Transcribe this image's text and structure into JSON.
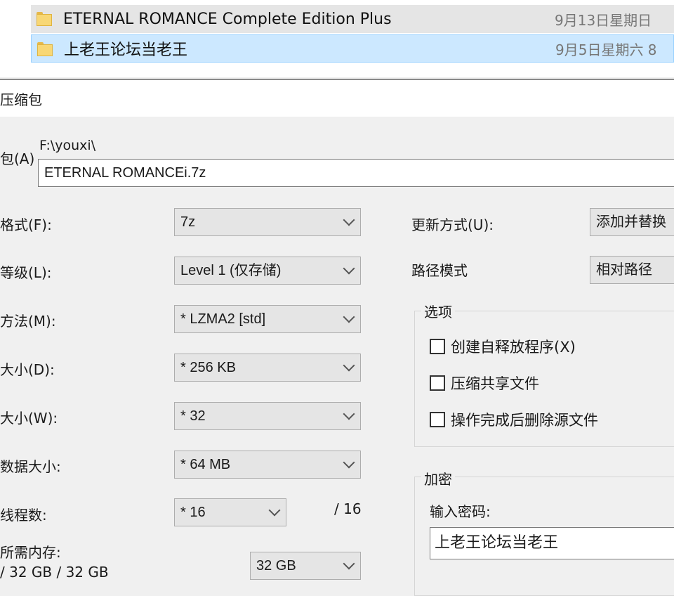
{
  "explorer": {
    "files": [
      {
        "name": "ETERNAL ROMANCE Complete Edition Plus",
        "date": "9月13日星期日",
        "icon": "folder-icon"
      },
      {
        "name": "上老王论坛当老王",
        "date": "9月5日星期六 8",
        "icon": "folder-icon"
      }
    ]
  },
  "dialog": {
    "title": "压缩包",
    "archive_label": "包(A)",
    "archive_path": "F:\\youxi\\",
    "archive_name": "ETERNAL ROMANCEi.7z",
    "left": {
      "format": {
        "label": "格式(F):",
        "value": "7z"
      },
      "level": {
        "label": "等级(L):",
        "value": "Level 1 (仅存储)"
      },
      "method": {
        "label": "方法(M):",
        "value": "* LZMA2 [std]"
      },
      "dict": {
        "label": "大小(D):",
        "value": "* 256 KB"
      },
      "word": {
        "label": "大小(W):",
        "value": "* 32"
      },
      "solid": {
        "label": "数据大小:",
        "value": "* 64 MB"
      },
      "threads": {
        "label": "线程数:",
        "value": "* 16",
        "max": "/ 16"
      },
      "memory": {
        "label": "所需内存:",
        "usage": "/ 32 GB / 32 GB",
        "value": "32 GB"
      }
    },
    "right": {
      "update": {
        "label": "更新方式(U):",
        "value": "添加并替换"
      },
      "pathmode": {
        "label": "路径模式",
        "value": "相对路径"
      },
      "options": {
        "title": "选项",
        "items": [
          "创建自释放程序(X)",
          "压缩共享文件",
          "操作完成后删除源文件"
        ]
      },
      "encryption": {
        "title": "加密",
        "password_label": "输入密码:",
        "password_value": "上老王论坛当老王"
      }
    }
  }
}
